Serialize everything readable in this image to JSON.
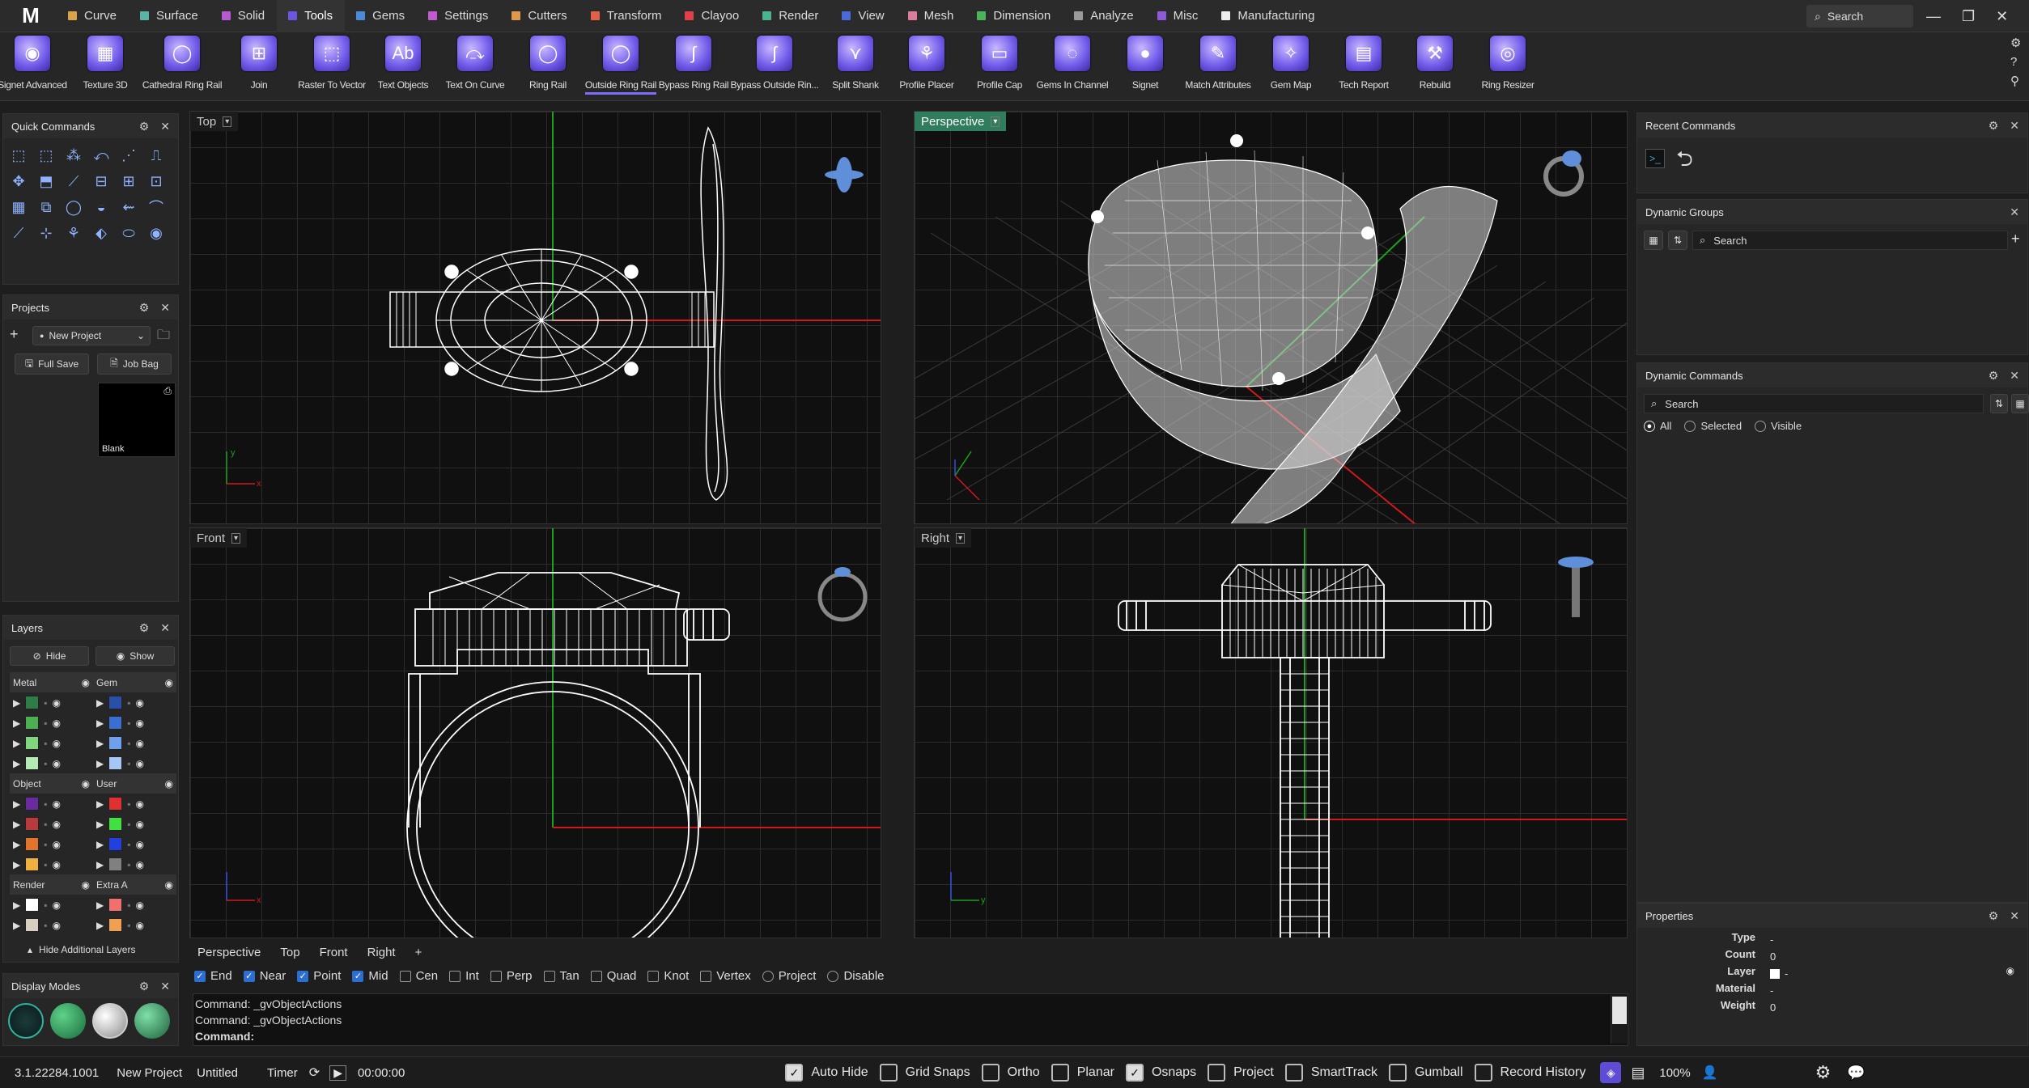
{
  "menubar": {
    "logo": "M",
    "tabs": [
      {
        "label": "Curve",
        "color": "#d9a34a"
      },
      {
        "label": "Surface",
        "color": "#5bb3a6"
      },
      {
        "label": "Solid",
        "color": "#b65acf"
      },
      {
        "label": "Tools",
        "color": "#6a56e0"
      },
      {
        "label": "Gems",
        "color": "#4a8ad9"
      },
      {
        "label": "Settings",
        "color": "#c05acf"
      },
      {
        "label": "Cutters",
        "color": "#e0984a"
      },
      {
        "label": "Transform",
        "color": "#e0604a"
      },
      {
        "label": "Clayoo",
        "color": "#e0404a"
      },
      {
        "label": "Render",
        "color": "#4ab38f"
      },
      {
        "label": "View",
        "color": "#4a6ad9"
      },
      {
        "label": "Mesh",
        "color": "#d97e9e"
      },
      {
        "label": "Dimension",
        "color": "#4ab35b"
      },
      {
        "label": "Analyze",
        "color": "#9a9a9a"
      },
      {
        "label": "Misc",
        "color": "#8e5ad9"
      },
      {
        "label": "Manufacturing",
        "color": "#eeeeee"
      }
    ],
    "search_placeholder": "Search"
  },
  "ribbon": {
    "tools": [
      {
        "label": "Signet Advanced",
        "glyph": "◉"
      },
      {
        "label": "Texture 3D",
        "glyph": "▦"
      },
      {
        "label": "Cathedral Ring Rail",
        "glyph": "◯"
      },
      {
        "label": "Join",
        "glyph": "⊞"
      },
      {
        "label": "Raster To Vector",
        "glyph": "⬚"
      },
      {
        "label": "Text Objects",
        "glyph": "Ab"
      },
      {
        "label": "Text On Curve",
        "glyph": "⤼"
      },
      {
        "label": "Ring Rail",
        "glyph": "◯"
      },
      {
        "label": "Outside Ring Rail",
        "glyph": "◯"
      },
      {
        "label": "Bypass Ring Rail",
        "glyph": "∫"
      },
      {
        "label": "Bypass Outside Rin...",
        "glyph": "∫"
      },
      {
        "label": "Split Shank",
        "glyph": "⋎"
      },
      {
        "label": "Profile Placer",
        "glyph": "⚘"
      },
      {
        "label": "Profile Cap",
        "glyph": "▭"
      },
      {
        "label": "Gems In Channel",
        "glyph": "◌"
      },
      {
        "label": "Signet",
        "glyph": "●"
      },
      {
        "label": "Match Attributes",
        "glyph": "✎"
      },
      {
        "label": "Gem Map",
        "glyph": "✧"
      },
      {
        "label": "Tech Report",
        "glyph": "▤"
      },
      {
        "label": "Rebuild",
        "glyph": "⚒"
      },
      {
        "label": "Ring Resizer",
        "glyph": "◎"
      }
    ],
    "active_tool": "Outside Ring Rail"
  },
  "quick_commands": {
    "title": "Quick Commands"
  },
  "projects": {
    "title": "Projects",
    "project_name": "New Project",
    "full_save": "Full Save",
    "job_bag": "Job Bag",
    "thumb_label": "Blank"
  },
  "layers": {
    "title": "Layers",
    "hide": "Hide",
    "show": "Show",
    "groups": [
      {
        "left": "Metal",
        "right": "Gem",
        "left_colors": [
          "#2e7d46",
          "#4caf50",
          "#7fd67f",
          "#b4eab4"
        ],
        "right_colors": [
          "#2950a8",
          "#3a6fd1",
          "#6ea0ee",
          "#a6c6f5"
        ]
      },
      {
        "left": "Object",
        "right": "User",
        "left_colors": [
          "#6a2aa0",
          "#b83a3a",
          "#e0742a",
          "#f0b040"
        ],
        "right_colors": [
          "#e03030",
          "#40e040",
          "#2040e0",
          "#808080"
        ]
      },
      {
        "left": "Render",
        "right": "Extra A",
        "left_colors": [
          "#ffffff",
          "#d8cfc0"
        ],
        "right_colors": [
          "#f07070",
          "#f0a050"
        ]
      }
    ],
    "hide_additional": "Hide Additional Layers"
  },
  "display_modes": {
    "title": "Display Modes"
  },
  "viewports": {
    "top": "Top",
    "perspective": "Perspective",
    "front": "Front",
    "right": "Right"
  },
  "view_tabs": [
    "Perspective",
    "Top",
    "Front",
    "Right",
    "+"
  ],
  "osnaps": [
    {
      "label": "End",
      "on": true
    },
    {
      "label": "Near",
      "on": true
    },
    {
      "label": "Point",
      "on": true
    },
    {
      "label": "Mid",
      "on": true
    },
    {
      "label": "Cen",
      "on": false
    },
    {
      "label": "Int",
      "on": false
    },
    {
      "label": "Perp",
      "on": false
    },
    {
      "label": "Tan",
      "on": false
    },
    {
      "label": "Quad",
      "on": false
    },
    {
      "label": "Knot",
      "on": false
    },
    {
      "label": "Vertex",
      "on": false
    },
    {
      "label": "Project",
      "on": false
    },
    {
      "label": "Disable",
      "on": false
    }
  ],
  "command": {
    "history": [
      "Command: _gvObjectActions",
      "Command: _gvObjectActions"
    ],
    "prompt": "Command:"
  },
  "right_panels": {
    "recent": "Recent Commands",
    "dyn_groups": "Dynamic Groups",
    "dyn_groups_search": "Search",
    "dyn_commands": "Dynamic Commands",
    "dyn_commands_search": "Search",
    "filters": [
      "All",
      "Selected",
      "Visible"
    ],
    "properties": "Properties",
    "props": [
      {
        "k": "Type",
        "v": "-"
      },
      {
        "k": "Count",
        "v": "0"
      },
      {
        "k": "Layer",
        "v": "-"
      },
      {
        "k": "Material",
        "v": "-"
      },
      {
        "k": "Weight",
        "v": "0"
      }
    ]
  },
  "status": {
    "version": "3.1.22284.1001",
    "project": "New Project",
    "file": "Untitled",
    "timer_label": "Timer",
    "timer_value": "00:00:00",
    "toggles": [
      {
        "label": "Auto Hide",
        "on": true
      },
      {
        "label": "Grid Snaps",
        "on": false
      },
      {
        "label": "Ortho",
        "on": false
      },
      {
        "label": "Planar",
        "on": false
      },
      {
        "label": "Osnaps",
        "on": true
      },
      {
        "label": "Project",
        "on": false
      },
      {
        "label": "SmartTrack",
        "on": false
      },
      {
        "label": "Gumball",
        "on": false
      },
      {
        "label": "Record History",
        "on": false
      }
    ],
    "zoom": "100%"
  }
}
